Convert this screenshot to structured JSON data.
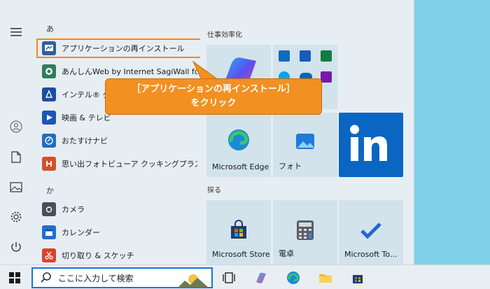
{
  "rail": {
    "items": [
      {
        "name": "hamburger-menu-button"
      },
      {
        "name": "user-account-button"
      },
      {
        "name": "documents-button"
      },
      {
        "name": "pictures-button"
      },
      {
        "name": "settings-button"
      },
      {
        "name": "power-button"
      }
    ]
  },
  "applist": {
    "letter_a": "あ",
    "letter_ka": "か",
    "apps": [
      {
        "label": "アプリケーションの再インストール",
        "icon": "reinstall-app-icon",
        "color": "#2f5f9e"
      },
      {
        "label": "あんしんWeb by Internet SagiWall for d",
        "icon": "anshin-web-icon",
        "color": "#2e7d5b"
      },
      {
        "label": "インテル® グラフ",
        "icon": "intel-graphics-icon",
        "color": "#1a4fa0"
      },
      {
        "label": "映画 & テレビ",
        "icon": "movies-tv-icon",
        "color": "#1c57b8"
      },
      {
        "label": "おたすけナビ",
        "icon": "otasuke-navi-icon",
        "color": "#1e6fc2"
      },
      {
        "label": "思い出フォトビューア クッキングプラス",
        "icon": "photo-viewer-icon",
        "color": "#d3502a"
      },
      {
        "label": "カメラ",
        "icon": "camera-icon",
        "color": "#4a4f57"
      },
      {
        "label": "カレンダー",
        "icon": "calendar-icon",
        "color": "#1f6fd1"
      },
      {
        "label": "切り取り & スケッチ",
        "icon": "snip-sketch-icon",
        "color": "#d9442b"
      }
    ]
  },
  "pinned": {
    "title": "仕事効率化",
    "explore_title": "探る",
    "tiles": {
      "edge": "Microsoft Edge",
      "photos": "フォト",
      "store": "Microsoft Store",
      "calculator": "電卓",
      "todo": "Microsoft To..."
    }
  },
  "callout": {
    "line1": "［アプリケーションの再インストール］",
    "line2": "をクリック"
  },
  "taskbar": {
    "search_placeholder": "ここに入力して検索"
  },
  "colors": {
    "accent": "#f29022",
    "highlight_border": "#f08a1c",
    "search_border": "#1a73d9",
    "linkedin": "#0a66c2"
  }
}
